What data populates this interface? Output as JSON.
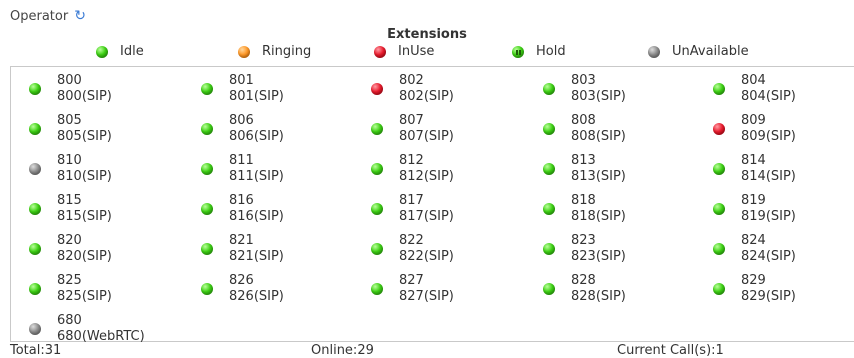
{
  "header": {
    "label": "Operator",
    "refresh_icon": "refresh-icon"
  },
  "extensions_title": "Extensions",
  "legend": [
    {
      "status": "idle",
      "label": "Idle"
    },
    {
      "status": "ringing",
      "label": "Ringing"
    },
    {
      "status": "inuse",
      "label": "InUse"
    },
    {
      "status": "hold",
      "label": "Hold"
    },
    {
      "status": "unavailable",
      "label": "UnAvailable"
    }
  ],
  "extensions": [
    {
      "number": "800",
      "detail": "800(SIP)",
      "status": "idle"
    },
    {
      "number": "801",
      "detail": "801(SIP)",
      "status": "idle"
    },
    {
      "number": "802",
      "detail": "802(SIP)",
      "status": "inuse"
    },
    {
      "number": "803",
      "detail": "803(SIP)",
      "status": "idle"
    },
    {
      "number": "804",
      "detail": "804(SIP)",
      "status": "idle"
    },
    {
      "number": "805",
      "detail": "805(SIP)",
      "status": "idle"
    },
    {
      "number": "806",
      "detail": "806(SIP)",
      "status": "idle"
    },
    {
      "number": "807",
      "detail": "807(SIP)",
      "status": "idle"
    },
    {
      "number": "808",
      "detail": "808(SIP)",
      "status": "idle"
    },
    {
      "number": "809",
      "detail": "809(SIP)",
      "status": "inuse"
    },
    {
      "number": "810",
      "detail": "810(SIP)",
      "status": "unavailable"
    },
    {
      "number": "811",
      "detail": "811(SIP)",
      "status": "idle"
    },
    {
      "number": "812",
      "detail": "812(SIP)",
      "status": "idle"
    },
    {
      "number": "813",
      "detail": "813(SIP)",
      "status": "idle"
    },
    {
      "number": "814",
      "detail": "814(SIP)",
      "status": "idle"
    },
    {
      "number": "815",
      "detail": "815(SIP)",
      "status": "idle"
    },
    {
      "number": "816",
      "detail": "816(SIP)",
      "status": "idle"
    },
    {
      "number": "817",
      "detail": "817(SIP)",
      "status": "idle"
    },
    {
      "number": "818",
      "detail": "818(SIP)",
      "status": "idle"
    },
    {
      "number": "819",
      "detail": "819(SIP)",
      "status": "idle"
    },
    {
      "number": "820",
      "detail": "820(SIP)",
      "status": "idle"
    },
    {
      "number": "821",
      "detail": "821(SIP)",
      "status": "idle"
    },
    {
      "number": "822",
      "detail": "822(SIP)",
      "status": "idle"
    },
    {
      "number": "823",
      "detail": "823(SIP)",
      "status": "idle"
    },
    {
      "number": "824",
      "detail": "824(SIP)",
      "status": "idle"
    },
    {
      "number": "825",
      "detail": "825(SIP)",
      "status": "idle"
    },
    {
      "number": "826",
      "detail": "826(SIP)",
      "status": "idle"
    },
    {
      "number": "827",
      "detail": "827(SIP)",
      "status": "idle"
    },
    {
      "number": "828",
      "detail": "828(SIP)",
      "status": "idle"
    },
    {
      "number": "829",
      "detail": "829(SIP)",
      "status": "idle"
    },
    {
      "number": "680",
      "detail": "680(WebRTC)",
      "status": "unavailable"
    }
  ],
  "footer": {
    "total": "Total:31",
    "online": "Online:29",
    "current_calls": "Current Call(s):1"
  },
  "colors": {
    "idle": "#3ed114",
    "ringing": "#ff9a2a",
    "inuse": "#e91c2e",
    "unavailable": "#8e8e8e"
  }
}
